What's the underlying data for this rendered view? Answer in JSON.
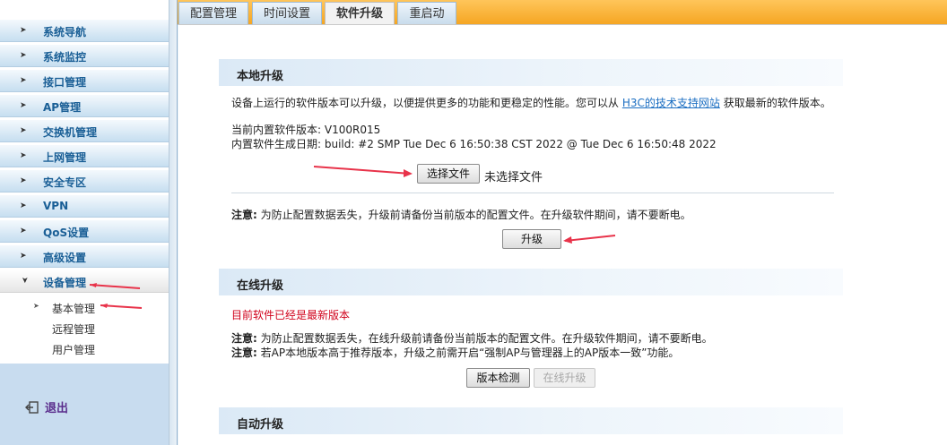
{
  "sidebar": {
    "items": [
      {
        "label": "系统导航"
      },
      {
        "label": "系统监控"
      },
      {
        "label": "接口管理"
      },
      {
        "label": "AP管理"
      },
      {
        "label": "交换机管理"
      },
      {
        "label": "上网管理"
      },
      {
        "label": "安全专区"
      },
      {
        "label": "VPN"
      },
      {
        "label": "QoS设置"
      },
      {
        "label": "高级设置"
      },
      {
        "label": "设备管理"
      }
    ],
    "sub_items": [
      {
        "label": "基本管理"
      },
      {
        "label": "远程管理"
      },
      {
        "label": "用户管理"
      }
    ],
    "logout_label": "退出"
  },
  "tabs": [
    {
      "label": "配置管理"
    },
    {
      "label": "时间设置"
    },
    {
      "label": "软件升级"
    },
    {
      "label": "重启动"
    }
  ],
  "local_upgrade": {
    "title": "本地升级",
    "desc_prefix": "设备上运行的软件版本可以升级，以便提供更多的功能和更稳定的性能。您可以从",
    "desc_link": "H3C的技术支持网站",
    "desc_suffix": "获取最新的软件版本。",
    "version_label": "当前内置软件版本:",
    "version_value": "V100R015",
    "build_label": "内置软件生成日期:",
    "build_value": "build: #2 SMP Tue Dec 6 16:50:38 CST 2022 @ Tue Dec 6 16:50:48 2022",
    "choose_file_label": "选择文件",
    "no_file_text": "未选择文件",
    "note_label": "注意:",
    "note_text": "为防止配置数据丢失，升级前请备份当前版本的配置文件。在升级软件期间，请不要断电。",
    "upgrade_button": "升级"
  },
  "online_upgrade": {
    "title": "在线升级",
    "status_text": "目前软件已经是最新版本",
    "note1_label": "注意:",
    "note1_text": "为防止配置数据丢失，在线升级前请备份当前版本的配置文件。在升级软件期间，请不要断电。",
    "note2_label": "注意:",
    "note2_text": "若AP本地版本高于推荐版本，升级之前需开启“强制AP与管理器上的AP版本一致”功能。",
    "check_button": "版本检测",
    "online_button": "在线升级"
  },
  "auto_upgrade": {
    "title": "自动升级"
  },
  "colors": {
    "tab_bar": "#f5a623",
    "sidebar_text": "#1a5f96",
    "annotation_arrow": "#e8334a",
    "status_red": "#d0021b"
  }
}
